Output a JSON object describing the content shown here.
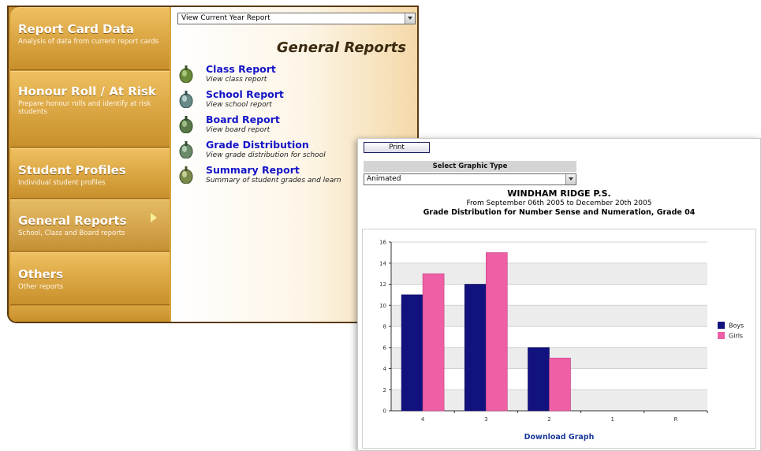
{
  "sidebar": {
    "items": [
      {
        "title": "Report Card Data",
        "desc": "Analysis of data from current report cards"
      },
      {
        "title": "Honour Roll / At Risk",
        "desc": "Prepare honour rolls and identify at risk students"
      },
      {
        "title": "Student Profiles",
        "desc": "Individual student profiles"
      },
      {
        "title": "General Reports",
        "desc": "School, Class and Board reports"
      },
      {
        "title": "Others",
        "desc": "Other reports"
      }
    ]
  },
  "content": {
    "year_select": "View Current Year Report",
    "heading": "General Reports",
    "reports": [
      {
        "title": "Class Report",
        "desc": "View class report",
        "icon": "number-1-icon"
      },
      {
        "title": "School Report",
        "desc": "View school report",
        "icon": "number-2-icon"
      },
      {
        "title": "Board Report",
        "desc": "View board report",
        "icon": "number-3-icon"
      },
      {
        "title": "Grade Distribution",
        "desc": "View grade distribution for school",
        "icon": "number-4-icon"
      },
      {
        "title": "Summary Report",
        "desc": "Summary of student grades and learn",
        "icon": "number-5-icon"
      }
    ]
  },
  "popup": {
    "print_label": "Print",
    "graphic_type_label": "Select Graphic Type",
    "graphic_type_value": "Animated",
    "school": "WINDHAM RIDGE P.S.",
    "period": "From September 06th 2005 to December 20th 2005",
    "subtitle": "Grade Distribution for Number Sense and Numeration, Grade 04",
    "download_label": "Download Graph"
  },
  "chart_data": {
    "type": "bar",
    "categories": [
      "4",
      "3",
      "2",
      "1",
      "R"
    ],
    "series": [
      {
        "name": "Boys",
        "values": [
          11,
          12,
          6,
          0,
          0
        ],
        "color": "#12127e"
      },
      {
        "name": "Girls",
        "values": [
          13,
          15,
          5,
          0,
          0
        ],
        "color": "#ee5fa6"
      }
    ],
    "yticks": [
      "0",
      "2",
      "4",
      "6",
      "8",
      "10",
      "12",
      "14",
      "16"
    ],
    "ylim": [
      0,
      16
    ],
    "grid": true,
    "legend": "right"
  },
  "colors": {
    "sidebar_gold": "#d9a441",
    "link_blue": "#1414c8",
    "boys": "#12127e",
    "girls": "#ee5fa6"
  }
}
